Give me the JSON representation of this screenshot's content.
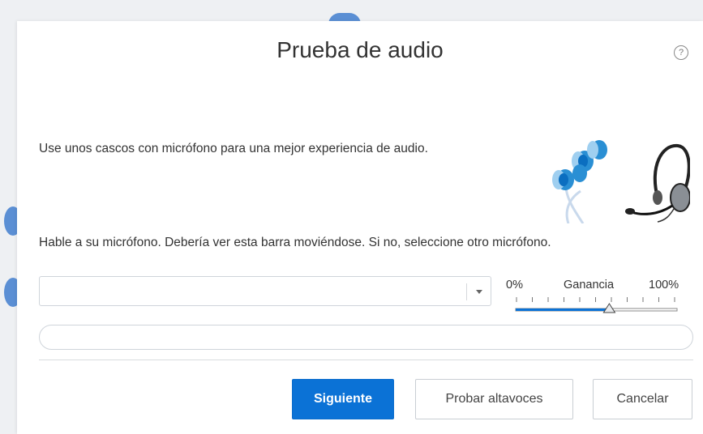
{
  "dialog": {
    "title": "Prueba de audio",
    "help_icon_symbol": "?",
    "headset_tip": "Use unos cascos con micrófono para una mejor experiencia de audio.",
    "mic_instruction": "Hable a su micrófono. Debería ver esta barra moviéndose. Si no, seleccione otro micrófono.",
    "microphone_select": {
      "value": ""
    },
    "gain": {
      "min_label": "0%",
      "label": "Ganancia",
      "max_label": "100%",
      "level": 0.58
    },
    "mic_level": 0,
    "buttons": {
      "next": "Siguiente",
      "test_speakers": "Probar altavoces",
      "cancel": "Cancelar"
    }
  },
  "colors": {
    "accent": "#0b72d6",
    "earbud": "#2a8fd4",
    "background": "#eef0f3"
  },
  "icons": [
    "help-icon",
    "earphones-icon",
    "headset-icon",
    "chevron-down-icon"
  ]
}
